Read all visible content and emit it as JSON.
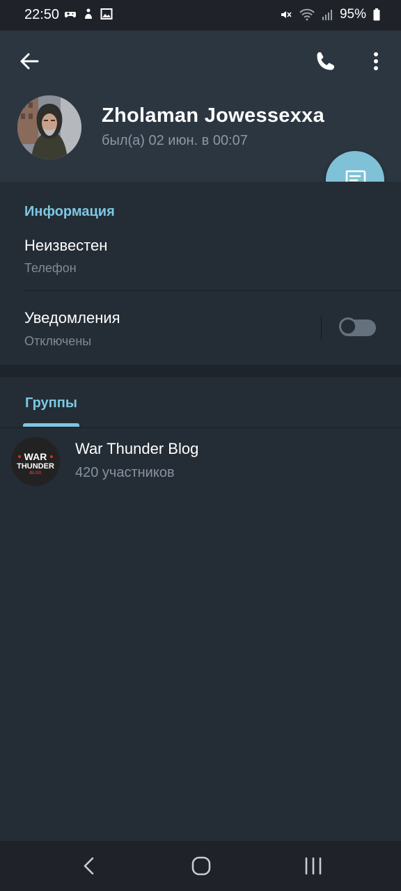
{
  "status_bar": {
    "time": "22:50",
    "battery": "95%"
  },
  "profile": {
    "name": "Zholaman Jowessexxa",
    "last_seen": "был(а) 02 июн. в 00:07"
  },
  "info": {
    "section_title": "Информация",
    "phone_value": "Неизвестен",
    "phone_label": "Телефон",
    "notifications_label": "Уведомления",
    "notifications_status": "Отключены",
    "notifications_enabled": false
  },
  "tabs": {
    "groups_label": "Группы"
  },
  "groups": [
    {
      "name": "War Thunder Blog",
      "members": "420 участников",
      "logo_text_1": "WAR",
      "logo_text_2": "THUNDER",
      "logo_text_3": "BLOG"
    }
  ],
  "colors": {
    "accent": "#7ec7e2",
    "fab": "#7fc1d7",
    "header_bg": "#2b3641",
    "page_bg": "#242c35"
  },
  "icons": {
    "back": "arrow-left-icon",
    "call": "phone-icon",
    "more": "more-vertical-icon",
    "fab": "message-icon"
  }
}
